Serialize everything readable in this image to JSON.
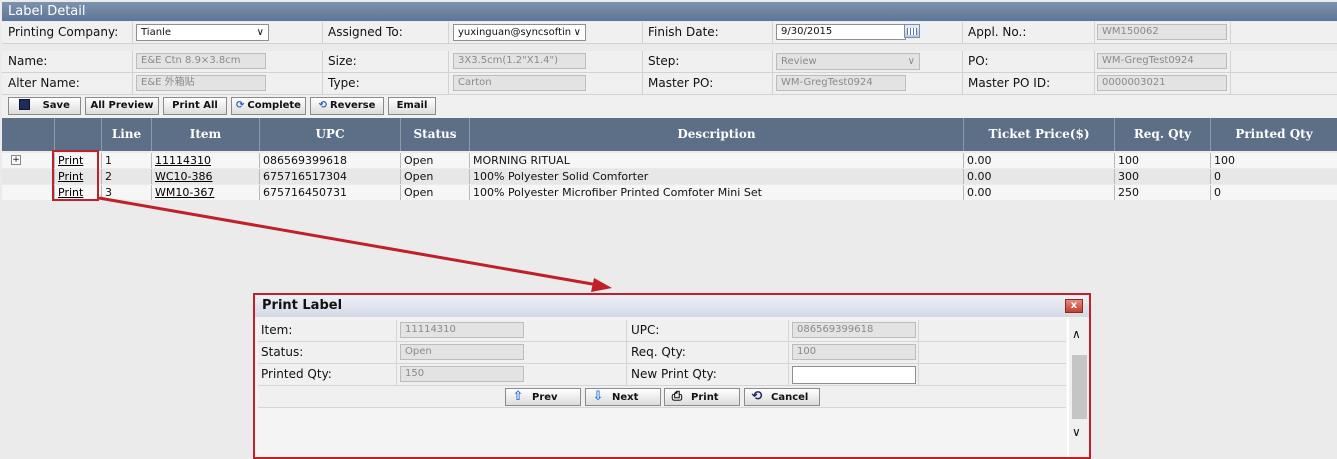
{
  "window": {
    "title": "Label Detail"
  },
  "header": {
    "printing_company": {
      "label": "Printing Company:",
      "value": "Tianle"
    },
    "assigned_to": {
      "label": "Assigned To:",
      "value": "yuxinguan@syncsoftin"
    },
    "finish_date": {
      "label": "Finish Date:",
      "value": "9/30/2015"
    },
    "appl_no": {
      "label": "Appl. No.:",
      "value": "WM150062"
    },
    "name": {
      "label": "Name:",
      "value": "E&E Ctn 8.9×3.8cm"
    },
    "size": {
      "label": "Size:",
      "value": "3X3.5cm(1.2\"X1.4\")"
    },
    "step": {
      "label": "Step:",
      "value": "Review"
    },
    "po": {
      "label": "PO:",
      "value": "WM-GregTest0924"
    },
    "alter_name": {
      "label": "Alter Name:",
      "value": "E&E 外箱贴"
    },
    "type": {
      "label": "Type:",
      "value": "Carton"
    },
    "master_po": {
      "label": "Master PO:",
      "value": "WM-GregTest0924"
    },
    "master_po_id": {
      "label": "Master PO ID:",
      "value": "0000003021"
    }
  },
  "toolbar": {
    "save": "Save",
    "all_preview": "All Preview",
    "print_all": "Print All",
    "complete": "Complete",
    "reverse": "Reverse",
    "email": "Email"
  },
  "grid": {
    "columns": {
      "line": "Line",
      "item": "Item",
      "upc": "UPC",
      "status": "Status",
      "description": "Description",
      "ticket_price": "Ticket Price($)",
      "req_qty": "Req. Qty",
      "printed_qty": "Printed Qty"
    },
    "rows": [
      {
        "expand": "+",
        "action": "Print",
        "line": "1",
        "item": "11114310",
        "upc": "086569399618",
        "status": "Open",
        "description": "MORNING RITUAL",
        "ticket_price": "0.00",
        "req_qty": "100",
        "printed_qty": "100"
      },
      {
        "expand": "",
        "action": "Print",
        "line": "2",
        "item": "WC10-386",
        "upc": "675716517304",
        "status": "Open",
        "description": "100% Polyester Solid Comforter",
        "ticket_price": "0.00",
        "req_qty": "300",
        "printed_qty": "0"
      },
      {
        "expand": "",
        "action": "Print",
        "line": "3",
        "item": "WM10-367",
        "upc": "675716450731",
        "status": "Open",
        "description": "100% Polyester Microfiber Printed Comfoter Mini Set",
        "ticket_price": "0.00",
        "req_qty": "250",
        "printed_qty": "0"
      }
    ]
  },
  "dialog": {
    "title": "Print Label",
    "close": "x",
    "item": {
      "label": "Item:",
      "value": "11114310"
    },
    "upc": {
      "label": "UPC:",
      "value": "086569399618"
    },
    "status": {
      "label": "Status:",
      "value": "Open"
    },
    "req_qty": {
      "label": "Req. Qty:",
      "value": "100"
    },
    "printed_qty": {
      "label": "Printed Qty:",
      "value": "150"
    },
    "new_print_qty": {
      "label": "New Print Qty:",
      "value": ""
    },
    "buttons": {
      "prev": "Prev",
      "next": "Next",
      "print": "Print",
      "cancel": "Cancel"
    }
  },
  "colors": {
    "title_bar": "#5d7596",
    "grid_header": "#5d6f86",
    "callout": "#c0202a"
  }
}
